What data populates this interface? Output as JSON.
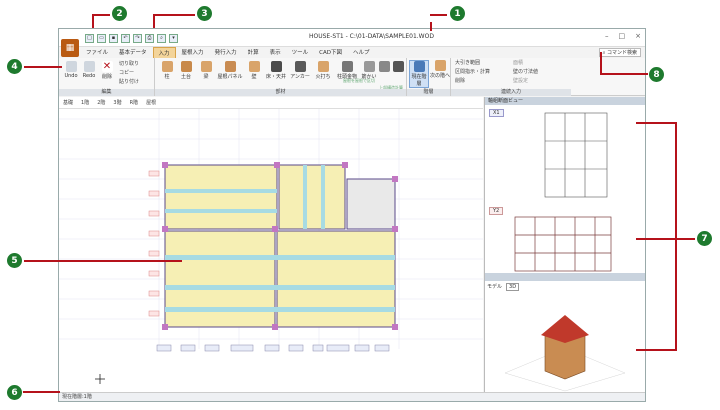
{
  "window_title": "HOUSE-ST1 - C:\\01-DATA\\SAMPLE01.WOD",
  "tabs": [
    "ファイル",
    "基本データ",
    "入力",
    "屋根入力",
    "発行入力",
    "計算",
    "表示",
    "ツール",
    "CAD下図",
    "ヘルプ"
  ],
  "active_tab": "入力",
  "help_search": "コマンド検索",
  "ribbon": {
    "edit": {
      "label": "編集",
      "undo": "Undo",
      "redo": "Redo",
      "delete": "削除",
      "cut": "切り取り",
      "copy": "コピー",
      "paste": "貼り付け"
    },
    "members": {
      "label": "部材",
      "items": [
        "柱",
        "土台",
        "梁",
        "屋根パネル",
        "壁",
        "床・天井",
        "アンカー",
        "火打ち",
        "柱頭金物",
        "筋かい",
        "屋根を屋根で区切",
        "上部構造計算"
      ]
    },
    "floor": {
      "label": "階層",
      "items": [
        "現在階層",
        "次の階へ"
      ]
    },
    "continuous": {
      "label": "連続入力",
      "items": [
        "大引き範囲",
        "区間指示・計算",
        "削除",
        "面積",
        "壁の寸法値",
        "壁設定"
      ]
    }
  },
  "floor_tabs": [
    "基礎",
    "1階",
    "2階",
    "3階",
    "R階",
    "屋根"
  ],
  "right_panel": {
    "elev_title": "軸組断面ビュー",
    "x_label": "X1",
    "y_label": "Y2",
    "view3d_tab": "3D",
    "view3d_tab2": "モデル"
  },
  "status": "現在階層:1階",
  "badges": [
    "1",
    "2",
    "3",
    "4",
    "5",
    "6",
    "7",
    "8"
  ],
  "colors": {
    "accent": "#b5121b",
    "badge": "#1e7a2e",
    "floor": "#f6efb4",
    "beam": "#a7dbe3"
  }
}
